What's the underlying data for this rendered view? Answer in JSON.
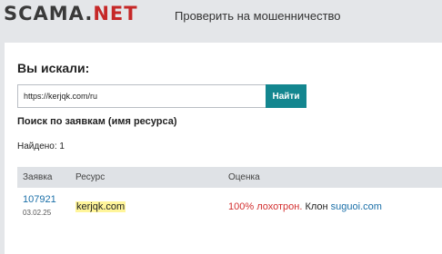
{
  "header": {
    "logo_main": "SCAMA.",
    "logo_accent": "NET",
    "nav_link": "Проверить на мошенничество"
  },
  "search": {
    "heading": "Вы искали:",
    "value": "https://kerjqk.com/ru",
    "button_label": "Найти"
  },
  "results": {
    "subheading": "Поиск по заявкам (имя ресурса)",
    "found_text": "Найдено: 1",
    "columns": [
      "Заявка",
      "Ресурс",
      "Оценка"
    ],
    "rows": [
      {
        "id": "107921",
        "date": "03.02.25",
        "resource": "kerjqk.com",
        "rating": "100% лохотрон.",
        "clone_label": "Клон",
        "clone_link": "suguoi.com"
      }
    ]
  },
  "colors": {
    "accent": "#13868f",
    "logo_accent": "#c62828",
    "danger": "#d32f2f",
    "link": "#1a6fa8",
    "highlight": "#fff59a"
  }
}
